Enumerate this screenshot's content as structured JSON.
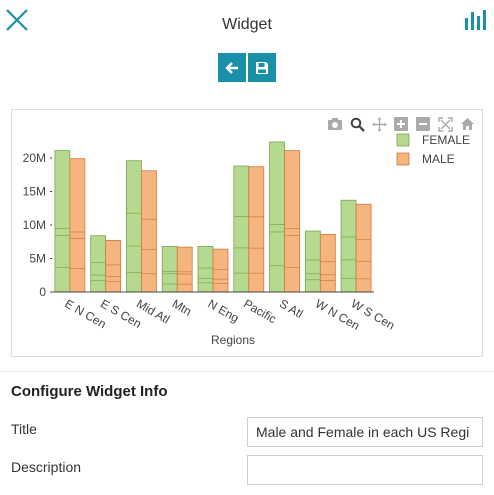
{
  "header": {
    "title": "Widget"
  },
  "toolbar": {
    "back_icon": "arrow-left-icon",
    "save_icon": "save-icon"
  },
  "modebar": {
    "icons": [
      "camera-icon",
      "zoom-icon",
      "pan-icon",
      "zoom-in-icon",
      "zoom-out-icon",
      "autoscale-icon",
      "home-icon"
    ]
  },
  "colors": {
    "female": "#b5d98f",
    "male": "#f6b47f",
    "accent": "#1a8fa8"
  },
  "chart_data": {
    "type": "bar",
    "xlabel": "Regions",
    "ylabel": "",
    "categories": [
      "E N Cen",
      "E S Cen",
      "Mid Atl",
      "Mtn",
      "N Eng",
      "Pacific",
      "S Atl",
      "W N Cen",
      "W S Cen"
    ],
    "series": [
      {
        "name": "FEMALE",
        "values": [
          21.1,
          8.4,
          19.6,
          6.8,
          6.8,
          18.8,
          22.4,
          9.1,
          13.7
        ]
      },
      {
        "name": "MALE",
        "values": [
          19.9,
          7.7,
          18.1,
          6.7,
          6.4,
          18.7,
          21.1,
          8.6,
          13.1
        ]
      }
    ],
    "yticks": [
      "0",
      "5M",
      "10M",
      "15M",
      "20M"
    ],
    "ylim": [
      0,
      23
    ],
    "legend": "top-right"
  },
  "config": {
    "section_title": "Configure Widget Info",
    "title_label": "Title",
    "title_value": "Male and Female in each US Regi",
    "description_label": "Description",
    "description_value": ""
  }
}
